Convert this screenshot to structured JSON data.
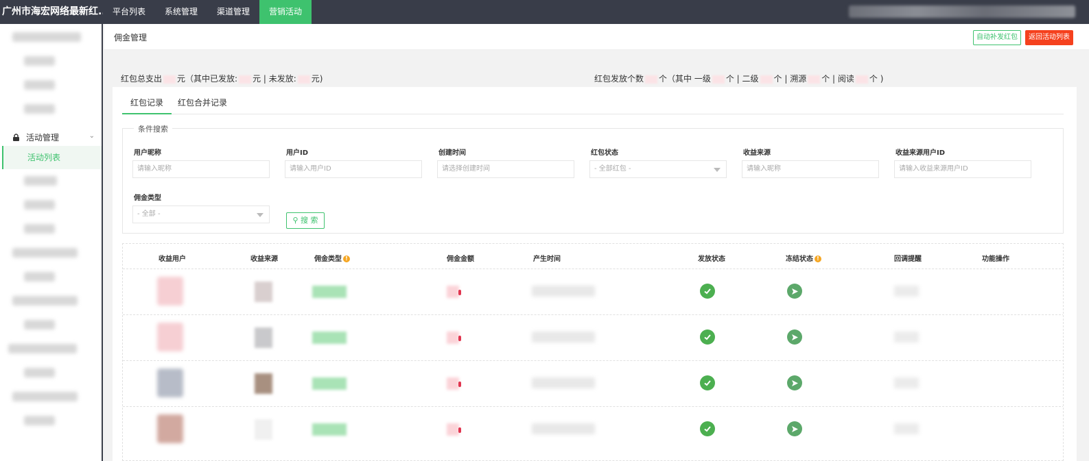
{
  "topbar": {
    "brand": "广州市海宏网络最新红...",
    "nav": [
      "平台列表",
      "系统管理",
      "渠道管理",
      "营销活动"
    ],
    "active_index": 3
  },
  "sidebar": {
    "group_label": "活动管理",
    "active_item": "活动列表"
  },
  "header": {
    "breadcrumb": "佣金管理",
    "btn_auto": "自动补发红包",
    "btn_back": "返回活动列表"
  },
  "summary": {
    "left_prefix": "红包总支出",
    "left_unit1": "元（其中已发放:",
    "left_unit2": "元 | 未发放:",
    "left_unit3": "元)",
    "right_prefix": "红包发放个数",
    "right_p1": "个（其中 一级",
    "right_p2": "个 | 二级",
    "right_p3": "个 | 溯源",
    "right_p4": "个 | 阅读",
    "right_p5": "个 )"
  },
  "tabs": [
    "红包记录",
    "红包合并记录"
  ],
  "filter": {
    "legend": "条件搜索",
    "fields": [
      {
        "label": "用户昵称",
        "placeholder": "请输入昵称"
      },
      {
        "label": "用户ID",
        "placeholder": "请输入用户ID"
      },
      {
        "label": "创建时间",
        "placeholder": "请选择创建时间"
      },
      {
        "label": "红包状态",
        "placeholder": "- 全部红包 -"
      },
      {
        "label": "收益来源",
        "placeholder": "请输入昵称"
      },
      {
        "label": "收益来源用户ID",
        "placeholder": "请输入收益来源用户ID"
      }
    ],
    "type_label": "佣金类型",
    "type_value": "- 全部 -",
    "search_label": "搜 索"
  },
  "table": {
    "columns": [
      "收益用户",
      "收益来源",
      "佣金类型",
      "佣金金额",
      "产生时间",
      "发放状态",
      "冻结状态",
      "回调提醒",
      "功能操作"
    ],
    "row_count": 4
  },
  "colors": {
    "accent": "#3ec26e",
    "danger": "#f5411e",
    "topbar": "#393d49"
  }
}
